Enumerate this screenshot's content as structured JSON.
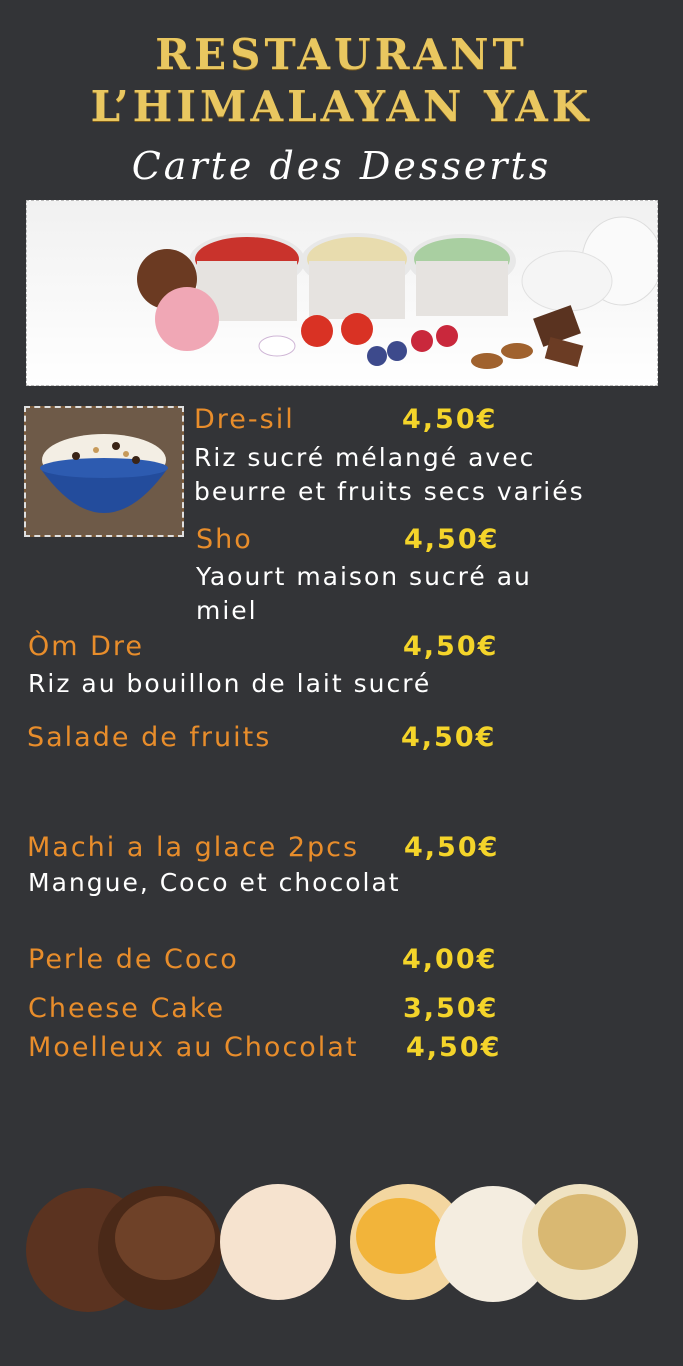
{
  "header": {
    "line1": "RESTAURANT",
    "line2": "L’HIMALAYAN YAK",
    "subtitle": "Carte des Desserts"
  },
  "menu": [
    {
      "name": "Dre-sil",
      "price": "4,50€",
      "desc1": "Riz sucré mélangé avec",
      "desc2": "beurre et fruits secs variés"
    },
    {
      "name": "Sho",
      "price": "4,50€",
      "desc1": "Yaourt maison sucré au",
      "desc2": "miel"
    },
    {
      "name": "Òm Dre",
      "price": "4,50€",
      "desc1": "Riz au bouillon de lait sucré"
    },
    {
      "name": "Salade de fruits",
      "price": "4,50€"
    },
    {
      "name": "Machi a la glace 2pcs",
      "price": "4,50€",
      "desc1": "Mangue, Coco et chocolat"
    },
    {
      "name": "Perle de Coco",
      "price": "4,00€"
    },
    {
      "name": "Cheese Cake",
      "price": "3,50€"
    },
    {
      "name": "Moelleux au Chocolat",
      "price": "4,50€"
    }
  ],
  "colors": {
    "background": "#333437",
    "title": "#e9c760",
    "item_name": "#e88d2b",
    "price": "#f4d42a"
  }
}
